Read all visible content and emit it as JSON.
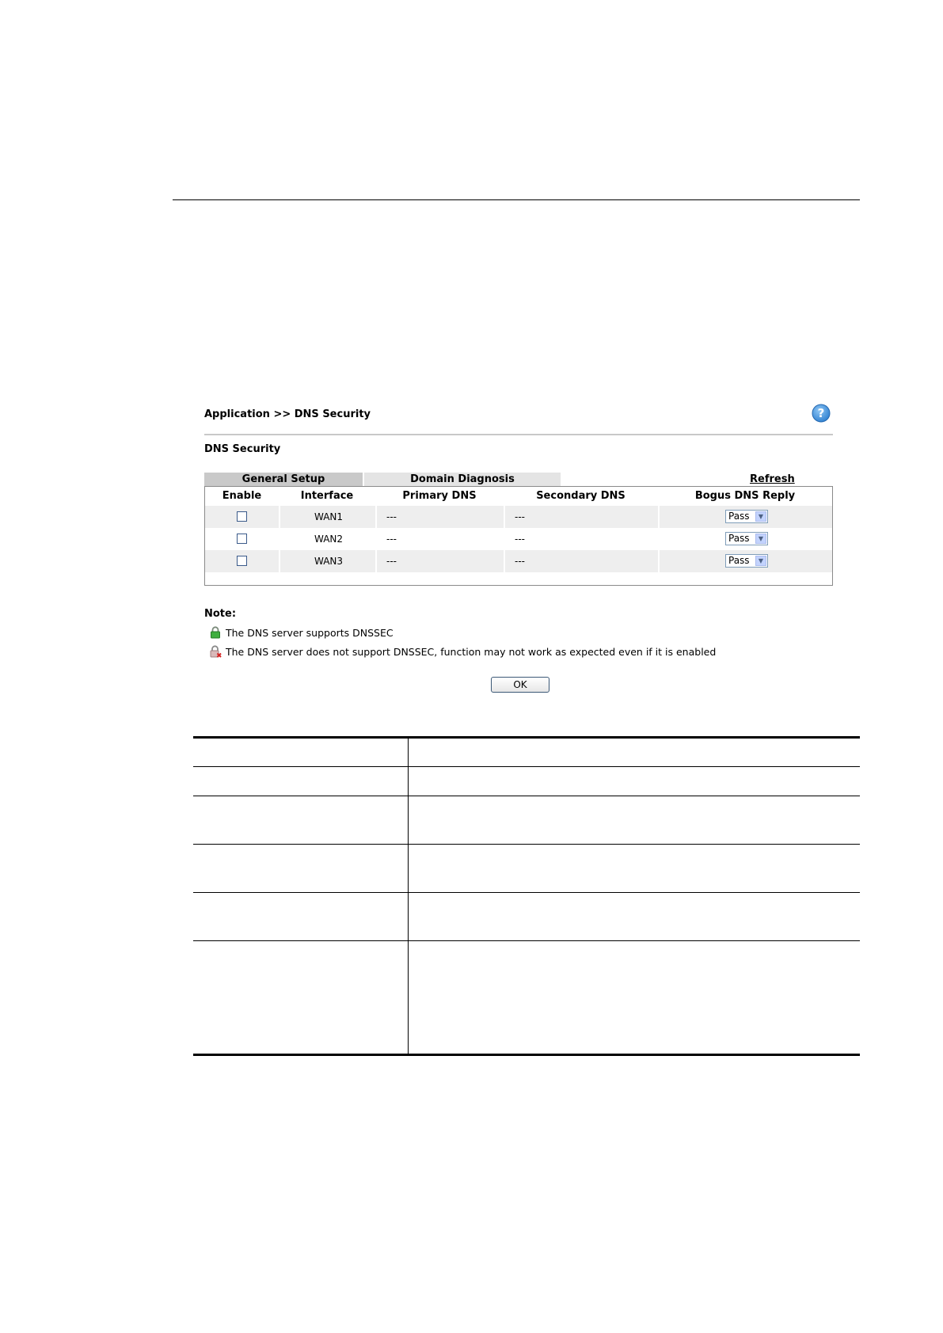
{
  "breadcrumb": "Application >> DNS Security",
  "section_title": "DNS Security",
  "tabs": [
    {
      "label": "General Setup",
      "active": true
    },
    {
      "label": "Domain Diagnosis",
      "active": false
    }
  ],
  "refresh_label": "Refresh",
  "table": {
    "headers": [
      "Enable",
      "Interface",
      "Primary DNS",
      "Secondary DNS",
      "Bogus DNS Reply"
    ],
    "rows": [
      {
        "enabled": false,
        "interface": "WAN1",
        "primary_dns": "---",
        "secondary_dns": "---",
        "bogus_dns_reply": "Pass"
      },
      {
        "enabled": false,
        "interface": "WAN2",
        "primary_dns": "---",
        "secondary_dns": "---",
        "bogus_dns_reply": "Pass"
      },
      {
        "enabled": false,
        "interface": "WAN3",
        "primary_dns": "---",
        "secondary_dns": "---",
        "bogus_dns_reply": "Pass"
      }
    ]
  },
  "note": {
    "label": "Note:",
    "items": [
      {
        "icon": "lock-green-icon",
        "text": "The DNS server supports DNSSEC"
      },
      {
        "icon": "lock-unsupported-icon",
        "text": "The DNS server does not support DNSSEC, function may not work as expected even if it is enabled"
      }
    ]
  },
  "ok_label": "OK",
  "colors": {
    "active_tab": "#c9c9c9",
    "inactive_tab": "#e4e4e4",
    "row_shade": "#eeeeee",
    "help_icon": "#3a8fd8"
  }
}
